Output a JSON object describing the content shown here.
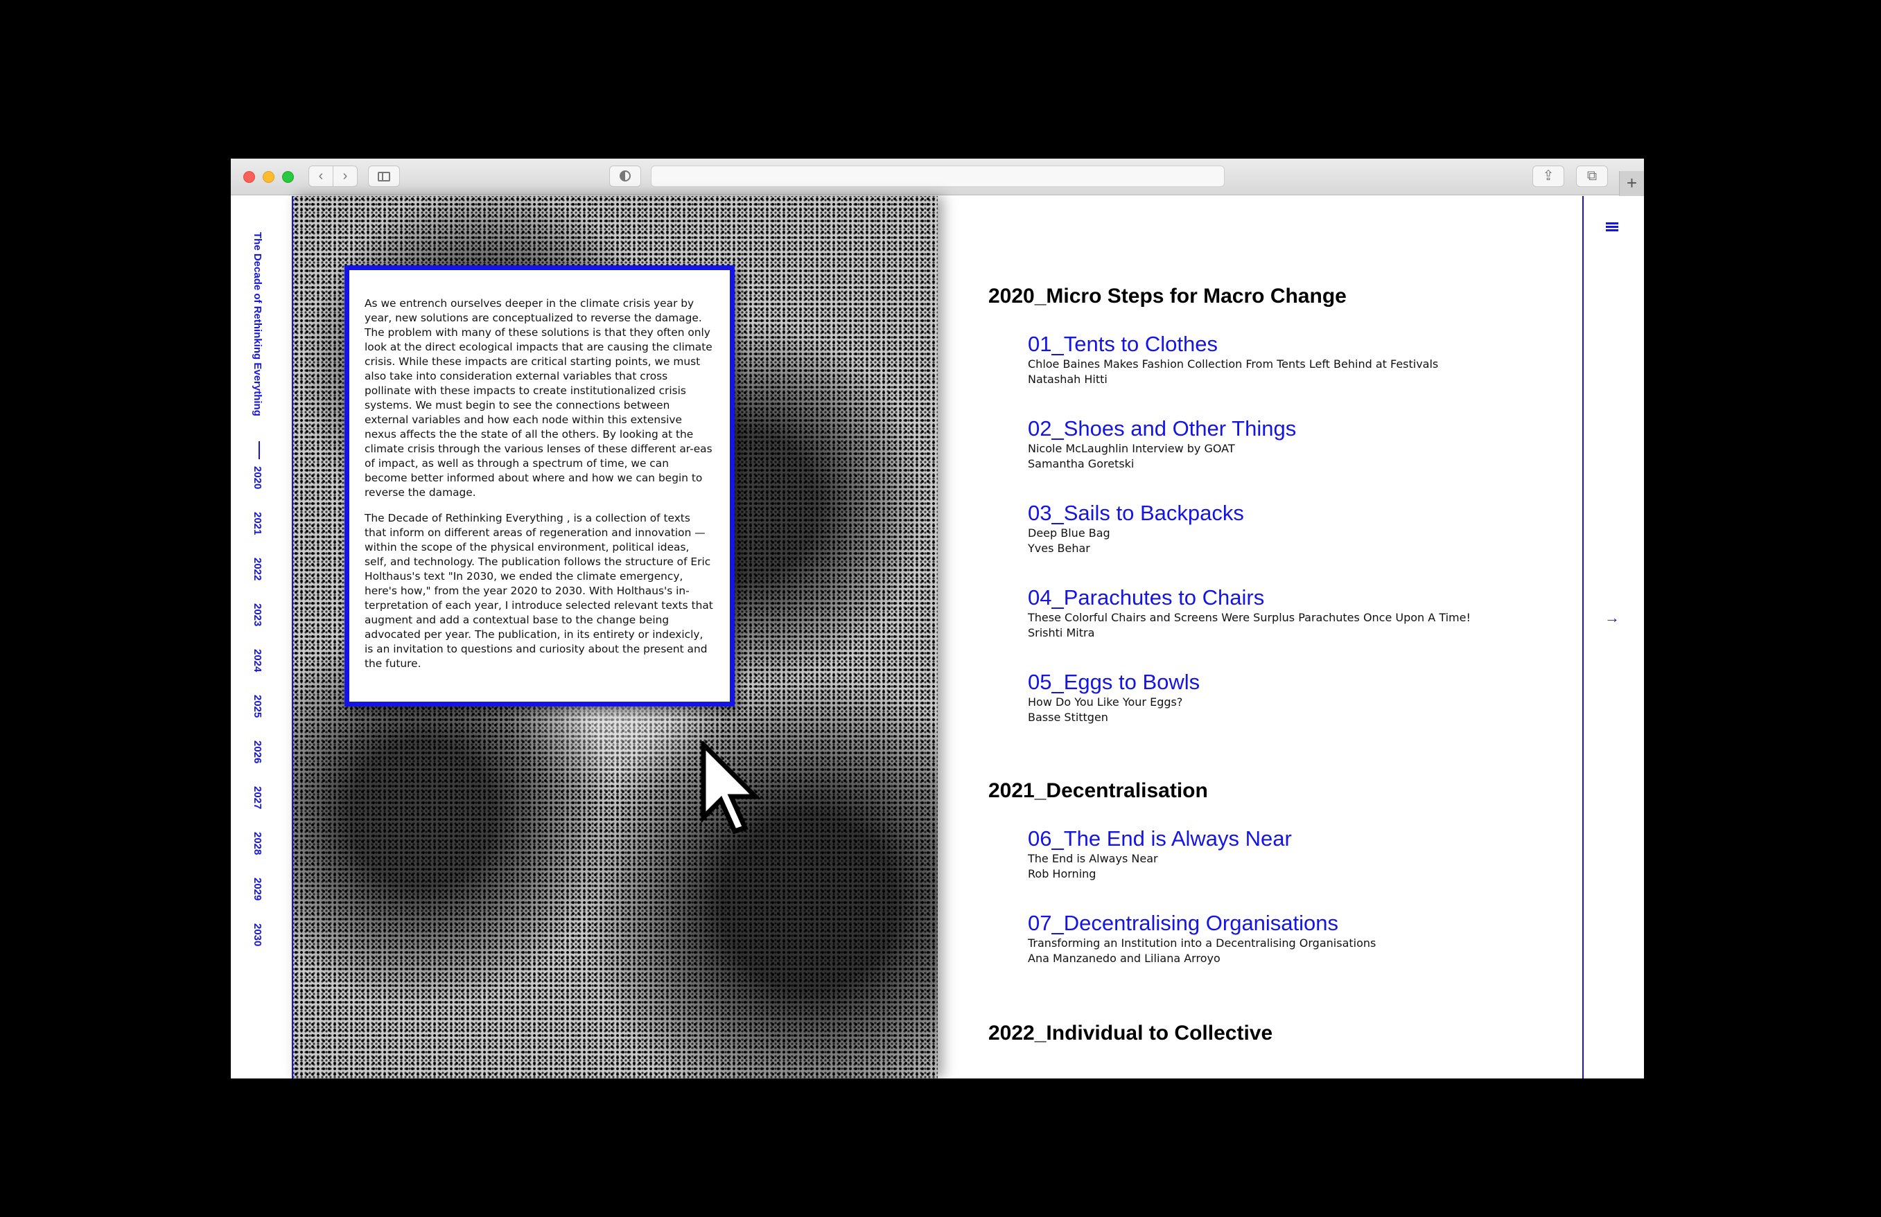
{
  "browser": {
    "back_icon": "‹",
    "forward_icon": "›",
    "newtab_icon": "+",
    "share_icon": "⇪",
    "tabs_icon": "⧉"
  },
  "site": {
    "vertical_title": "The Decade of Rethinking Everything",
    "years": [
      "2020",
      "2021",
      "2022",
      "2023",
      "2024",
      "2025",
      "2026",
      "2027",
      "2028",
      "2029",
      "2030"
    ],
    "accent_color": "#1414e6"
  },
  "intro": {
    "paragraph1": "As we entrench ourselves deeper in the climate crisis year by year, new solutions are conceptualized to reverse the damage. The problem with many of these solutions is that they often only look at the direct ecological impacts that are causing the climate crisis. While these impacts are critical starting points, we must also take into consideration external variables that cross pollinate with these impacts to create institutionalized crisis systems. We must begin to see the connections between external variables and how each node within this extensive nexus affects the the state of all the others. By looking at the climate crisis through the various lenses of these different ar-eas of impact, as well as through a spectrum of time, we can become better informed about where and how we can begin to reverse the damage.",
    "paragraph2": "The Decade of Rethinking Everything , is a collection of texts that inform on different areas of regeneration and innovation — within the scope of the physical environment, political ideas, self, and technology. The publication follows the structure of Eric Holthaus's text \"In 2030, we ended the climate emergency, here's how,\" from the year 2020 to 2030. With Holthaus's in-terpretation of each year, I introduce selected relevant texts that augment and add a contextual base to the change being advocated per year. The publication, in its entirety or indexicly, is an invitation to questions and curiosity about the present and the future."
  },
  "sections": [
    {
      "heading": "2020_Micro Steps for Macro Change",
      "entries": [
        {
          "title": "01_Tents to Clothes",
          "subtitle": "Chloe Baines Makes Fashion Collection From Tents Left Behind at Festivals",
          "author": "Natashah Hitti"
        },
        {
          "title": "02_Shoes and Other Things",
          "subtitle": "Nicole McLaughlin Interview by GOAT",
          "author": "Samantha Goretski"
        },
        {
          "title": "03_Sails to Backpacks",
          "subtitle": "Deep Blue Bag",
          "author": "Yves Behar"
        },
        {
          "title": "04_Parachutes to Chairs",
          "subtitle": "These Colorful Chairs and Screens Were Surplus Parachutes Once Upon A Time!",
          "author": "Srishti Mitra"
        },
        {
          "title": "05_Eggs to Bowls",
          "subtitle": "How Do You Like Your Eggs?",
          "author": "Basse Stittgen"
        }
      ]
    },
    {
      "heading": "2021_Decentralisation",
      "entries": [
        {
          "title": "06_The End is Always Near",
          "subtitle": "The End is Always Near",
          "author": "Rob Horning"
        },
        {
          "title": "07_Decentralising Organisations",
          "subtitle": "Transforming an Institution into a Decentralising Organisations",
          "author": "Ana Manzanedo and Liliana Arroyo"
        }
      ]
    },
    {
      "heading": "2022_Individual to Collective",
      "entries": []
    }
  ],
  "rail": {
    "menu_icon": "menu-icon",
    "arrow": "→"
  }
}
